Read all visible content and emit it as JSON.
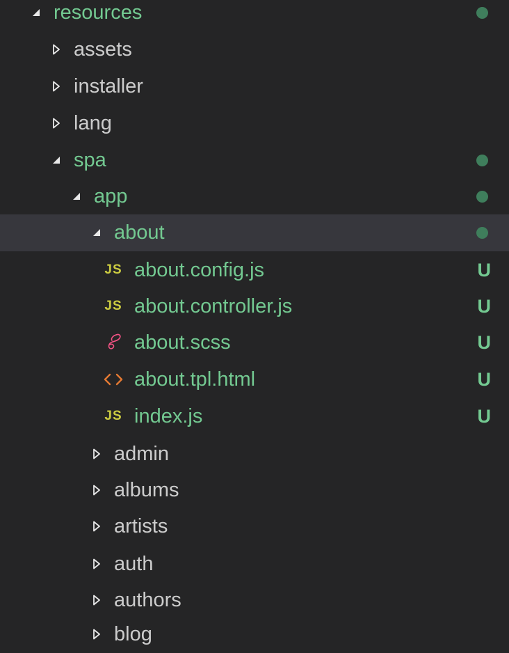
{
  "explorer": {
    "colors": {
      "background": "#252526",
      "selected": "#37373d",
      "modified": "#73c991",
      "dot": "#3f7e5c",
      "folder_text": "#cccccc",
      "js": "#cbcb41",
      "scss": "#f55385",
      "html": "#e37933"
    },
    "rows": [
      {
        "label": "resources",
        "expanded": true,
        "kind": "folder",
        "git": "dot"
      },
      {
        "label": "assets",
        "expanded": false,
        "kind": "folder",
        "git": ""
      },
      {
        "label": "installer",
        "expanded": false,
        "kind": "folder",
        "git": ""
      },
      {
        "label": "lang",
        "expanded": false,
        "kind": "folder",
        "git": ""
      },
      {
        "label": "spa",
        "expanded": true,
        "kind": "folder",
        "git": "dot"
      },
      {
        "label": "app",
        "expanded": true,
        "kind": "folder",
        "git": "dot"
      },
      {
        "label": "about",
        "expanded": true,
        "kind": "folder",
        "git": "dot",
        "selected": true
      },
      {
        "label": "about.config.js",
        "kind": "file",
        "icon": "js-file-icon",
        "icon_text": "JS",
        "git": "U"
      },
      {
        "label": "about.controller.js",
        "kind": "file",
        "icon": "js-file-icon",
        "icon_text": "JS",
        "git": "U"
      },
      {
        "label": "about.scss",
        "kind": "file",
        "icon": "sass-file-icon",
        "git": "U"
      },
      {
        "label": "about.tpl.html",
        "kind": "file",
        "icon": "html-file-icon",
        "git": "U"
      },
      {
        "label": "index.js",
        "kind": "file",
        "icon": "js-file-icon",
        "icon_text": "JS",
        "git": "U"
      },
      {
        "label": "admin",
        "expanded": false,
        "kind": "folder",
        "git": ""
      },
      {
        "label": "albums",
        "expanded": false,
        "kind": "folder",
        "git": ""
      },
      {
        "label": "artists",
        "expanded": false,
        "kind": "folder",
        "git": ""
      },
      {
        "label": "auth",
        "expanded": false,
        "kind": "folder",
        "git": ""
      },
      {
        "label": "authors",
        "expanded": false,
        "kind": "folder",
        "git": ""
      },
      {
        "label": "blog",
        "expanded": false,
        "kind": "folder",
        "git": ""
      }
    ]
  }
}
